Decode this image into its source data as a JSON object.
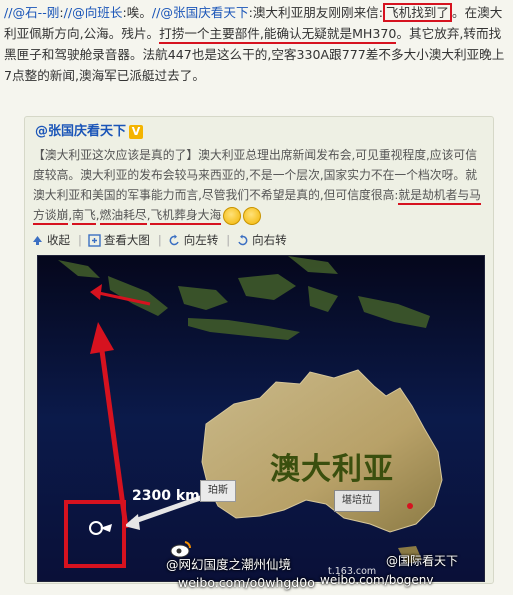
{
  "post": {
    "mention1": "//@石--刚",
    "sep1": ":",
    "mention2": "//@向班长",
    "part1": ":唉。",
    "mention3": "//@张国庆看天下",
    "part2": ":澳大利亚朋友刚刚来信:",
    "hl1": "飞机找到了",
    "part3": "。在澳大利亚佩斯方向,公海。残片。",
    "hl2": "打捞一个主要部件,能确认无疑就是",
    "hl3": "MH370",
    "part4": "。其它放弃,转而找黑匣子和驾驶舱录音器。法航447也是这么干的,空客330A跟777差不多大小澳大利亚晚上7点整的新闻,澳海军已派艇过去了。"
  },
  "repost": {
    "author": "@张国庆看天下",
    "badge": "V",
    "text1": "【澳大利亚这次应该是真的了】澳大利亚总理出席新闻发布会,可见重视程度,应该可信度较高。澳大利亚的发布会较马来西亚的,不是一个层次,国家实力不在一个档次呀。就澳大利亚和美国的军事能力而言,尽管我们不希望是真的,但可信度很高:",
    "hl1": "就是劫机者与马方谈崩",
    "text2": ",",
    "hl2": "南飞",
    "text3": ",",
    "hl3": "燃油耗尽",
    "text4": ",",
    "hl4": "飞机葬身大海",
    "toolbar": {
      "collapse": "收起",
      "view_large": "查看大图",
      "rotate_left": "向左转",
      "rotate_right": "向右转"
    }
  },
  "map": {
    "country_label": "澳大利亚",
    "distance_label": "2300 km",
    "origin_label": "珀斯",
    "city_label": "堪培拉"
  },
  "watermarks": {
    "line1": "@网幻国度之潮州仙境",
    "line2": "weibo.com/o0whgd0o",
    "line3": "@国际看天下",
    "line4": "weibo.com/bogenv",
    "line5": "t.163.com"
  },
  "colors": {
    "highlight": "#d6121f",
    "link": "#1a55b8",
    "map_bg": "#0a0d22",
    "land": "#a9925a",
    "arrow": "#d6121f"
  }
}
